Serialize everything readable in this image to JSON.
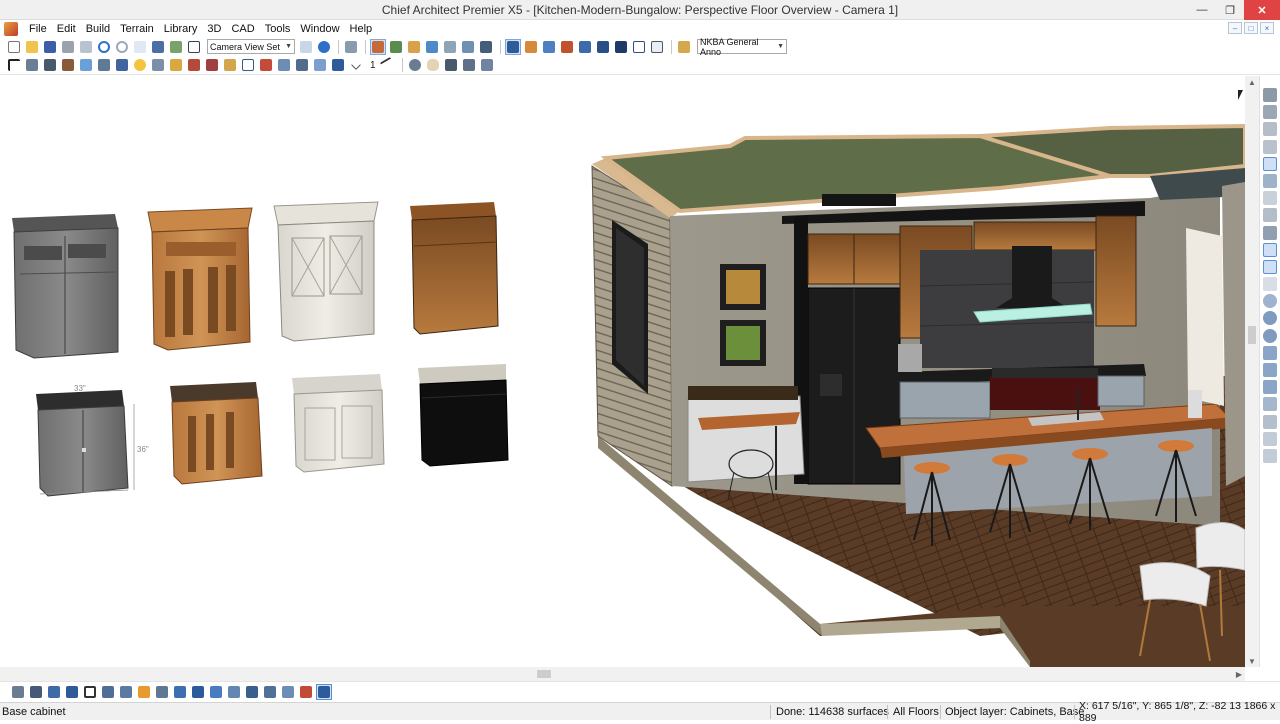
{
  "window": {
    "title": "Chief Architect Premier X5 - [Kitchen-Modern-Bungalow: Perspective Floor Overview - Camera 1]"
  },
  "menu": {
    "items": [
      "File",
      "Edit",
      "Build",
      "Terrain",
      "Library",
      "3D",
      "CAD",
      "Tools",
      "Window",
      "Help"
    ]
  },
  "toolbar": {
    "view_set": "Camera View Set",
    "annotation_set": "NKBA General Anno",
    "scale_value": "1"
  },
  "cabinets_catalog": [
    {
      "name": "Gray painted wall hutch cabinet",
      "style": "gray"
    },
    {
      "name": "Oak wall hutch cabinet",
      "style": "oak"
    },
    {
      "name": "White glass-door hutch cabinet",
      "style": "white"
    },
    {
      "name": "Walnut wall cabinet",
      "style": "walnut"
    },
    {
      "name": "Gray base cabinet",
      "style": "gray"
    },
    {
      "name": "Oak base cabinet",
      "style": "oak"
    },
    {
      "name": "White base cabinet",
      "style": "white"
    },
    {
      "name": "Black base cabinet",
      "style": "black"
    }
  ],
  "dimensions": {
    "width_label": "33\"",
    "height_label": "36\""
  },
  "status": {
    "selected_object": "Base cabinet",
    "done": "Done:  114638 surfaces",
    "floors": "All Floors",
    "layer": "Object layer: Cabinets,  Base",
    "coords": "X: 617 5/16\", Y: 865 1/8\", Z: -82 13  1866 x 889"
  },
  "colors": {
    "accent": "#1a73c7",
    "titlebar": "#f0f0f0",
    "close_button": "#e04343",
    "floor": "#5a3b26",
    "ceiling_green": "#5f6e49"
  }
}
